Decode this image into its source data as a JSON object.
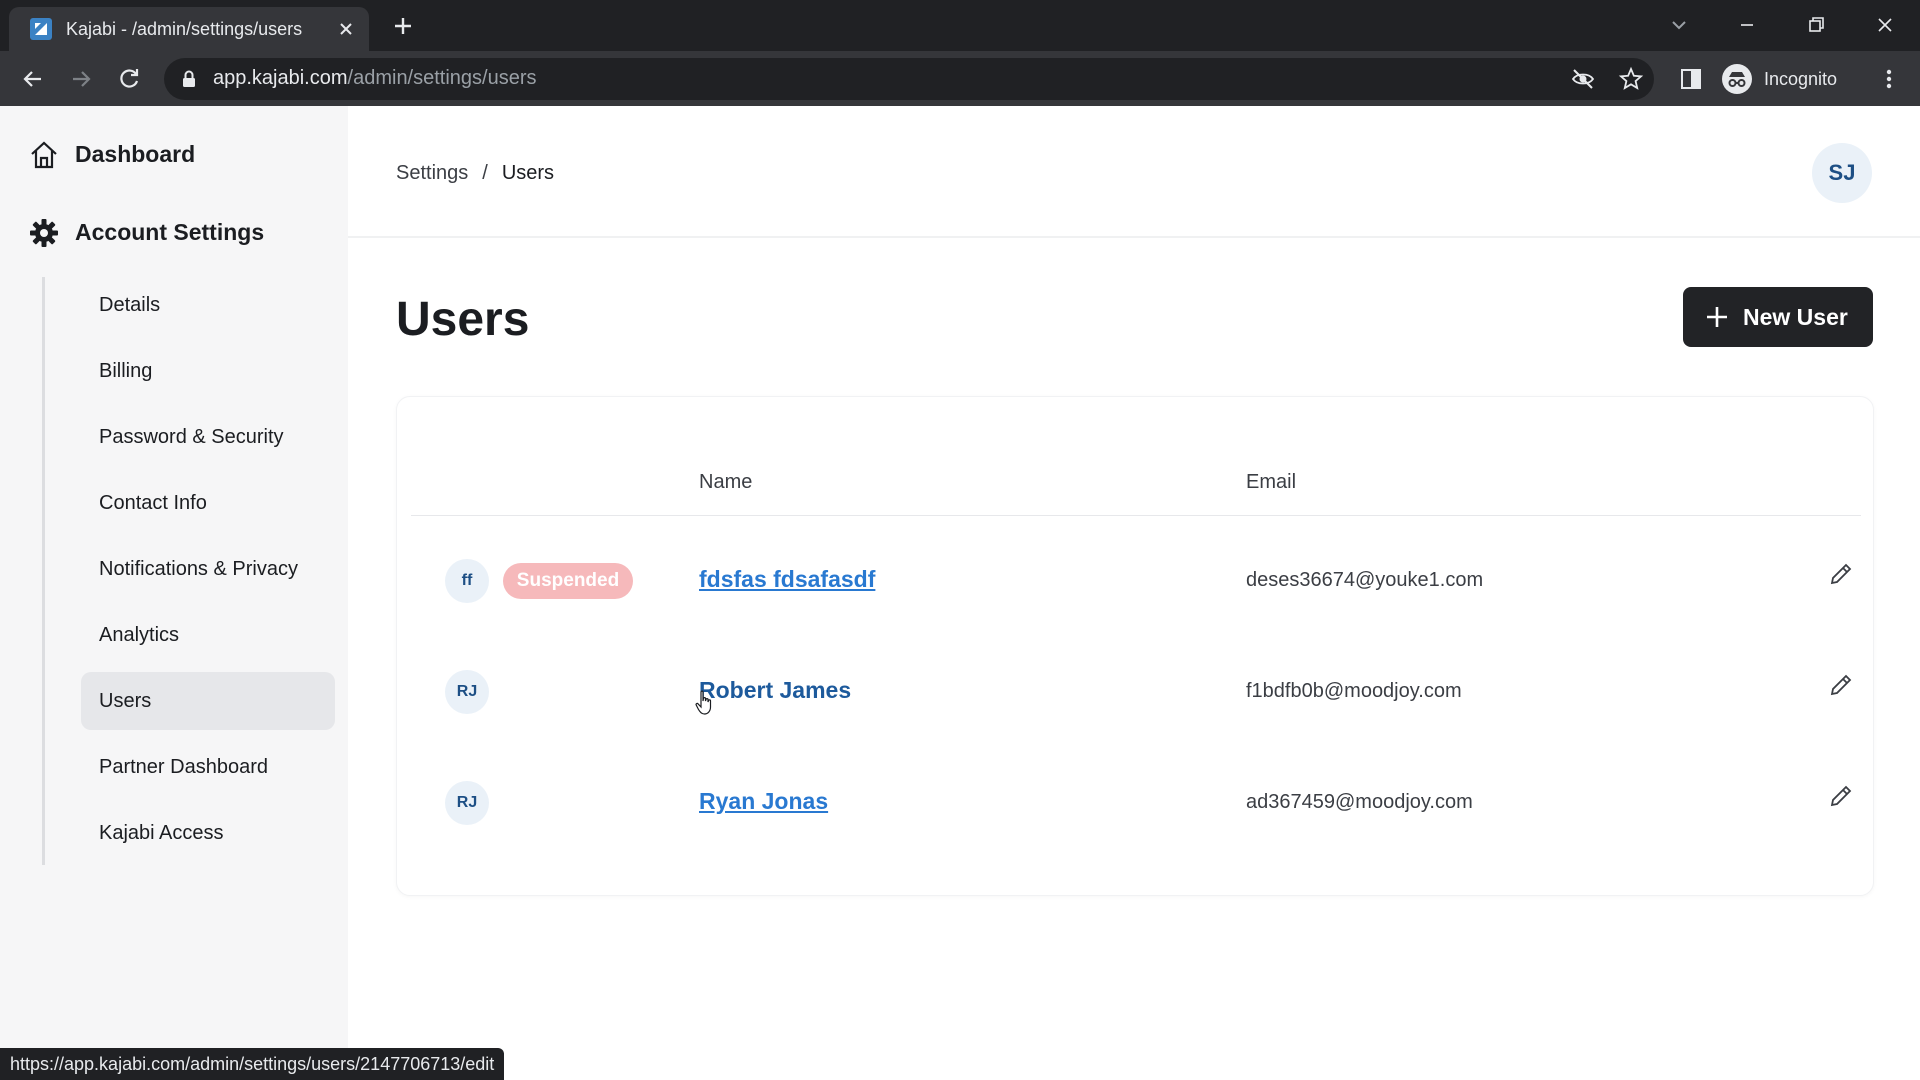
{
  "browser": {
    "tab_title": "Kajabi - /admin/settings/users",
    "url_host": "app.kajabi.com",
    "url_path": "/admin/settings/users",
    "profile_label": "Incognito",
    "status_url": "https://app.kajabi.com/admin/settings/users/2147706713/edit"
  },
  "sidebar": {
    "dashboard_label": "Dashboard",
    "account_settings_label": "Account Settings",
    "items": [
      {
        "label": "Details"
      },
      {
        "label": "Billing"
      },
      {
        "label": "Password & Security"
      },
      {
        "label": "Contact Info"
      },
      {
        "label": "Notifications & Privacy"
      },
      {
        "label": "Analytics"
      },
      {
        "label": "Users"
      },
      {
        "label": "Partner Dashboard"
      },
      {
        "label": "Kajabi Access"
      }
    ]
  },
  "header": {
    "breadcrumb_root": "Settings",
    "breadcrumb_sep": "/",
    "breadcrumb_current": "Users",
    "user_initials": "SJ"
  },
  "page": {
    "title": "Users",
    "new_user_label": "New User"
  },
  "table": {
    "columns": {
      "name": "Name",
      "email": "Email"
    },
    "rows": [
      {
        "initials": "ff",
        "badge": "Suspended",
        "name": "fdsfas fdsafasdf",
        "email": "deses36674@youke1.com"
      },
      {
        "initials": "RJ",
        "badge": "",
        "name": "Robert James",
        "email": "f1bdfb0b@moodjoy.com"
      },
      {
        "initials": "RJ",
        "badge": "",
        "name": "Ryan Jonas",
        "email": "ad367459@moodjoy.com"
      }
    ]
  },
  "colors": {
    "suspended_badge": "#f6b9bb",
    "link": "#2979d1",
    "primary_button": "#222326"
  }
}
